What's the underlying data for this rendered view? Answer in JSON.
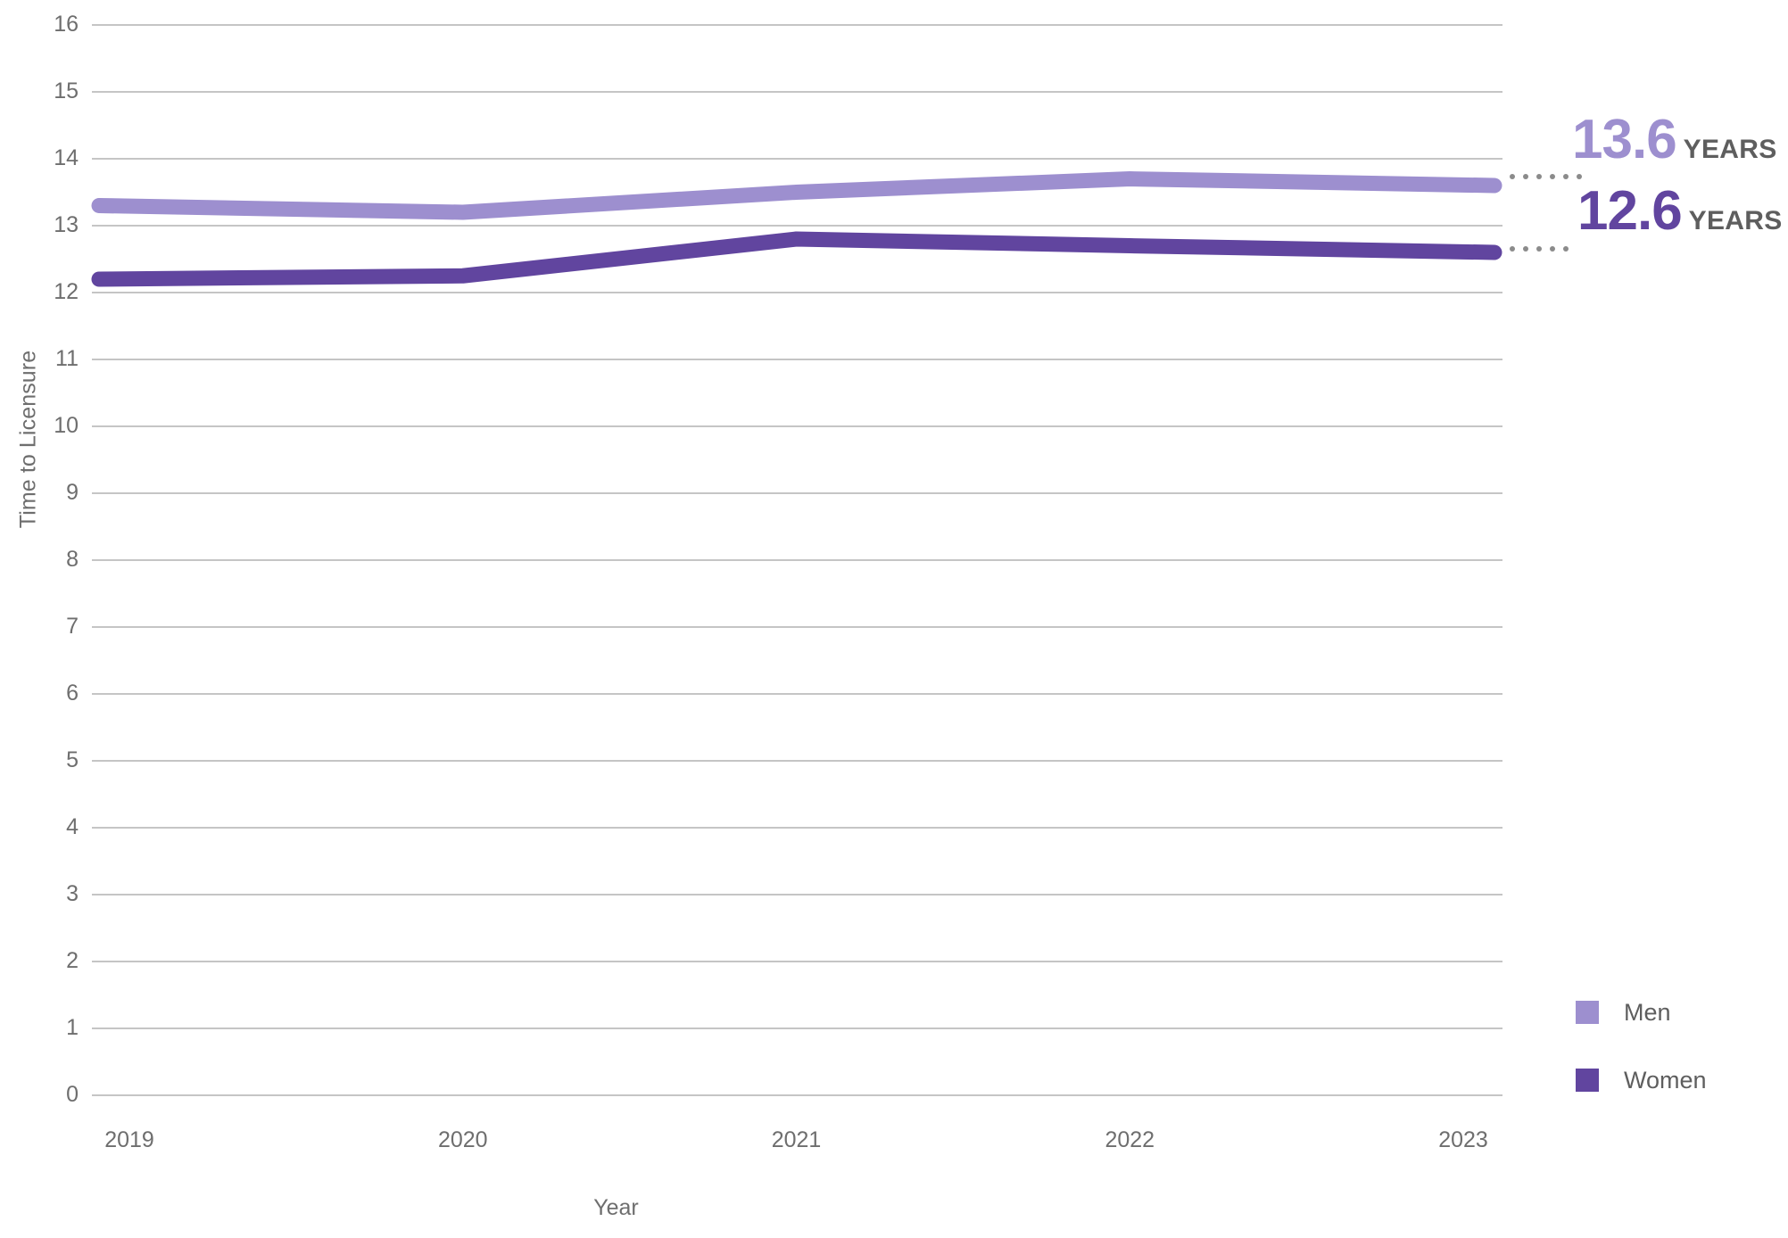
{
  "chart_data": {
    "type": "line",
    "title": "",
    "xlabel": "Year",
    "ylabel": "Time to Licensure",
    "categories": [
      "2019",
      "2020",
      "2021",
      "2022",
      "2023"
    ],
    "x_tick_labels": [
      "2019",
      "2020",
      "2021",
      "2022",
      "2023"
    ],
    "y_tick_labels": [
      "16",
      "15",
      "14",
      "13",
      "12",
      "11",
      "10",
      "9",
      "8",
      "7",
      "6",
      "5",
      "4",
      "3",
      "2",
      "1",
      "0"
    ],
    "ylim": [
      0,
      16
    ],
    "xlim": [
      "2019",
      "2023"
    ],
    "grid": true,
    "legend_position": "right-bottom",
    "series": [
      {
        "name": "Men",
        "color": "#9d8fcf",
        "values": [
          13.3,
          13.2,
          13.5,
          13.7,
          13.6
        ],
        "end_label_value": "13.6",
        "end_label_unit": "YEARS"
      },
      {
        "name": "Women",
        "color": "#61459f",
        "values": [
          12.2,
          12.25,
          12.8,
          12.7,
          12.6
        ],
        "end_label_value": "12.6",
        "end_label_unit": "YEARS"
      }
    ]
  },
  "axes": {
    "y_title": "Time to Licensure",
    "x_title": "Year"
  },
  "callouts": [
    {
      "value": "13.6",
      "unit": "YEARS",
      "color": "#9d8fcf"
    },
    {
      "value": "12.6",
      "unit": "YEARS",
      "color": "#61459f"
    }
  ],
  "legend": {
    "items": [
      {
        "label": "Men",
        "color": "#9d8fcf"
      },
      {
        "label": "Women",
        "color": "#61459f"
      }
    ]
  },
  "colors": {
    "men": "#9d8fcf",
    "women": "#61459f",
    "gridline": "#b2b2b2",
    "axis_text": "#6e6e6e",
    "unit_text": "#5e5e5e",
    "background": "#ffffff"
  }
}
